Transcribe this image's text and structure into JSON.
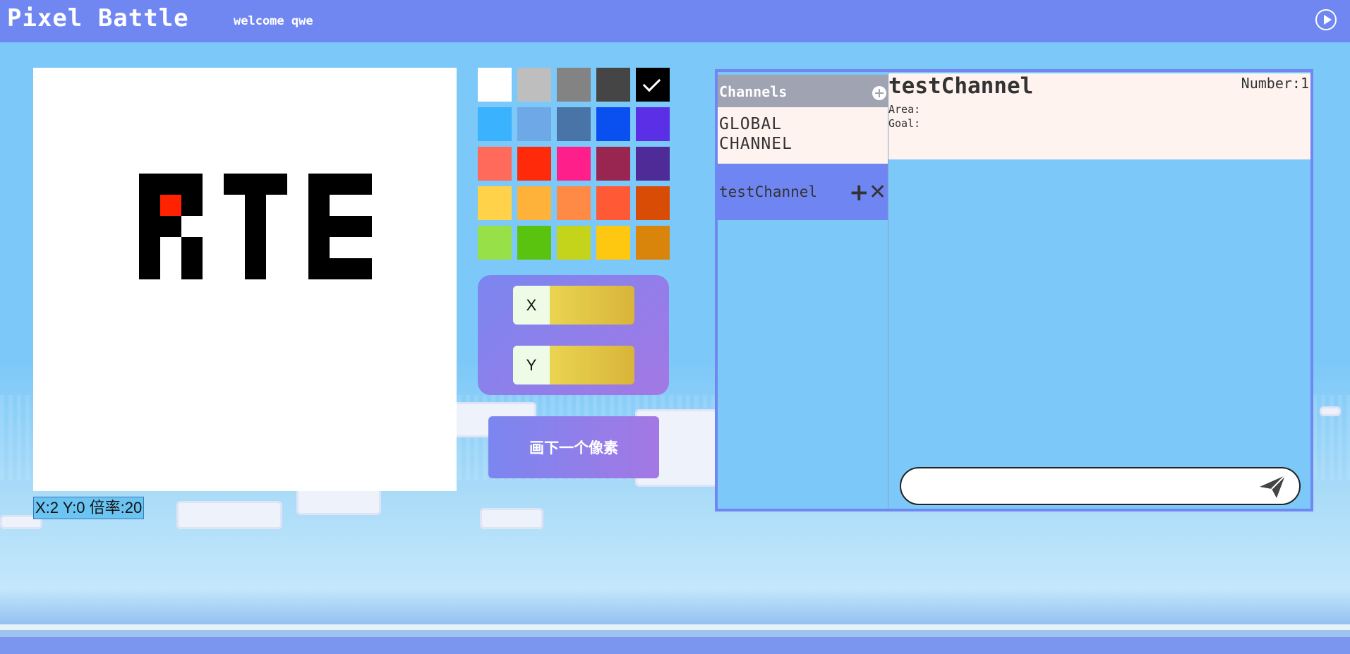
{
  "header": {
    "title": "Pixel Battle",
    "welcome": "welcome qwe"
  },
  "canvas": {
    "status": "X:2 Y:0 倍率:20"
  },
  "palette": {
    "selected_index": 4,
    "colors": [
      "#ffffff",
      "#bebebe",
      "#838383",
      "#454545",
      "#000000",
      "#3ab2fd",
      "#6ea8e6",
      "#4874a8",
      "#0a4ff0",
      "#5a2fe6",
      "#ff6a5a",
      "#ff2a0a",
      "#ff1f8a",
      "#992650",
      "#4e2b96",
      "#ffd24a",
      "#ffb23a",
      "#ff8a45",
      "#ff5a35",
      "#d94c06",
      "#98e048",
      "#5ac310",
      "#c4d41a",
      "#ffc810",
      "#d9840a"
    ]
  },
  "coords_panel": {
    "x_label": "X",
    "y_label": "Y",
    "x_value": "",
    "y_value": ""
  },
  "draw_button": {
    "label": "画下一个像素"
  },
  "channels": {
    "title": "Channels",
    "items": [
      {
        "name": "GLOBAL CHANNEL"
      },
      {
        "name": "testChannel"
      }
    ]
  },
  "channel_info": {
    "name": "testChannel",
    "number": "Number:1",
    "area": "Area:",
    "goal": "Goal:"
  },
  "message": {
    "placeholder": ""
  },
  "colors": {
    "header": "#7087f2",
    "sky": "#7cc8f8",
    "accent": "#ff2200"
  }
}
